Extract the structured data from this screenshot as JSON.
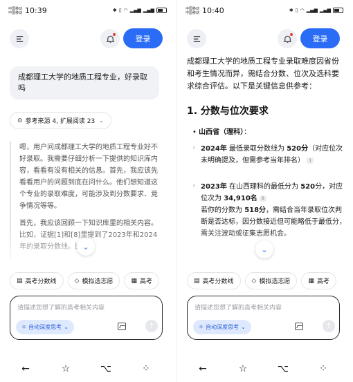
{
  "left": {
    "status": {
      "carrier1": "中国移动",
      "carrier2": "中国移动",
      "time": "10:39"
    },
    "login_label": "登录",
    "query": "成都理工大学的地质工程专业，好录取吗",
    "sources_label": "参考来源 4, 扩展阅读 23",
    "thought_p1": "嗯，用户问成都理工大学的地质工程专业好不好录取。我需要仔细分析一下提供的知识库内容，看看有没有相关的信息。首先，我应该先看看用户的问题到底在问什么。他们想知道这个专业的录取难度，可能涉及到分数要求、竞争情况等等。",
    "thought_p2": "首先，我应该回顾一下知识库里的相关内容。比如，证据[1]和[8]里提到了2023年和2024年的录取分数线。比",
    "chips": [
      "高考分数线",
      "模拟选志愿",
      "高考"
    ],
    "placeholder": "请描述您想了解的高考相关内容",
    "deep_label": "自动深度思考"
  },
  "right": {
    "status": {
      "carrier1": "中国移动",
      "carrier2": "中国移动",
      "time": "10:40"
    },
    "login_label": "登录",
    "intro": "成都理工大学的地质工程专业录取难度因省份和考生情况而异，需结合分数、位次及选科要求综合评估。以下是关键信息供参考：",
    "heading": "1. 分数与位次要求",
    "province_label": "山西省（理科）",
    "province_suffix": "：",
    "item1_year": "2024年",
    "item1_text1": " 最低录取分数线为 ",
    "item1_score": "520分",
    "item1_text2": "（对应位次未明确提及，但需参考当年排名）",
    "item1_cite": "1",
    "item2_year": "2023年",
    "item2_text1": " 在山西理科的最低分为 ",
    "item2_score": "520",
    "item2_text2": "分",
    "item2_text3": "，对应位次为 ",
    "item2_rank": "34,910名",
    "item2_cite": "8",
    "item2_text4": "若你的分数为 ",
    "item2_score2": "518分",
    "item2_text5": "，需结合当年录取位次判断是否达标，因分数接近但可能略低于最低分，需关注波动或征集志愿机会。",
    "chips": [
      "高考分数线",
      "模拟选志愿",
      "高考"
    ],
    "placeholder": "请描述您想了解的高考相关内容",
    "deep_label": "自动深度思考"
  },
  "icons": {
    "menu": "menu-icon",
    "bell": "bell-icon",
    "back": "back-arrow-icon",
    "star": "star-icon",
    "share": "share-icon",
    "more": "more-dots-icon",
    "image": "image-icon",
    "send": "send-arrow-icon",
    "chevron_down": "chevron-down-icon",
    "atom": "atom-icon"
  },
  "colors": {
    "accent": "#2b6cf6",
    "notify_dot": "#e5383b",
    "deep_bg": "#dfe9fe"
  }
}
